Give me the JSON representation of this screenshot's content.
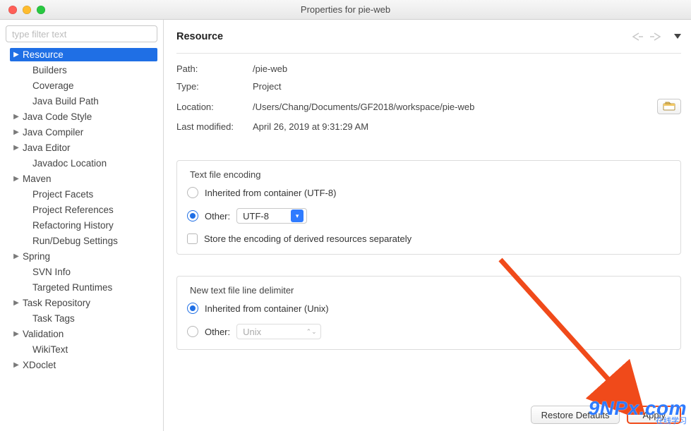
{
  "window": {
    "title": "Properties for pie-web"
  },
  "sidebar": {
    "filter_placeholder": "type filter text",
    "items": [
      {
        "label": "Resource",
        "arrow": true,
        "selected": true,
        "depth": 0
      },
      {
        "label": "Builders",
        "arrow": false,
        "selected": false,
        "depth": 1
      },
      {
        "label": "Coverage",
        "arrow": false,
        "selected": false,
        "depth": 1
      },
      {
        "label": "Java Build Path",
        "arrow": false,
        "selected": false,
        "depth": 1
      },
      {
        "label": "Java Code Style",
        "arrow": true,
        "selected": false,
        "depth": 0
      },
      {
        "label": "Java Compiler",
        "arrow": true,
        "selected": false,
        "depth": 0
      },
      {
        "label": "Java Editor",
        "arrow": true,
        "selected": false,
        "depth": 0
      },
      {
        "label": "Javadoc Location",
        "arrow": false,
        "selected": false,
        "depth": 1
      },
      {
        "label": "Maven",
        "arrow": true,
        "selected": false,
        "depth": 0
      },
      {
        "label": "Project Facets",
        "arrow": false,
        "selected": false,
        "depth": 1
      },
      {
        "label": "Project References",
        "arrow": false,
        "selected": false,
        "depth": 1
      },
      {
        "label": "Refactoring History",
        "arrow": false,
        "selected": false,
        "depth": 1
      },
      {
        "label": "Run/Debug Settings",
        "arrow": false,
        "selected": false,
        "depth": 1
      },
      {
        "label": "Spring",
        "arrow": true,
        "selected": false,
        "depth": 0
      },
      {
        "label": "SVN Info",
        "arrow": false,
        "selected": false,
        "depth": 1
      },
      {
        "label": "Targeted Runtimes",
        "arrow": false,
        "selected": false,
        "depth": 1
      },
      {
        "label": "Task Repository",
        "arrow": true,
        "selected": false,
        "depth": 0
      },
      {
        "label": "Task Tags",
        "arrow": false,
        "selected": false,
        "depth": 1
      },
      {
        "label": "Validation",
        "arrow": true,
        "selected": false,
        "depth": 0
      },
      {
        "label": "WikiText",
        "arrow": false,
        "selected": false,
        "depth": 1
      },
      {
        "label": "XDoclet",
        "arrow": true,
        "selected": false,
        "depth": 0
      }
    ]
  },
  "main": {
    "heading": "Resource",
    "props": {
      "path_label": "Path:",
      "path_value": "/pie-web",
      "type_label": "Type:",
      "type_value": "Project",
      "location_label": "Location:",
      "location_value": "/Users/Chang/Documents/GF2018/workspace/pie-web",
      "modified_label": "Last modified:",
      "modified_value": "April 26, 2019 at 9:31:29 AM"
    },
    "encoding": {
      "legend": "Text file encoding",
      "inherited_label": "Inherited from container (UTF-8)",
      "other_label": "Other:",
      "other_value": "UTF-8",
      "derived_label": "Store the encoding of derived resources separately"
    },
    "delimiter": {
      "legend": "New text file line delimiter",
      "inherited_label": "Inherited from container (Unix)",
      "other_label": "Other:",
      "other_value": "Unix"
    },
    "buttons": {
      "restore": "Restore Defaults",
      "apply": "Apply"
    }
  },
  "watermark": {
    "line1": "9NPx.com",
    "line2": "在线学习"
  }
}
